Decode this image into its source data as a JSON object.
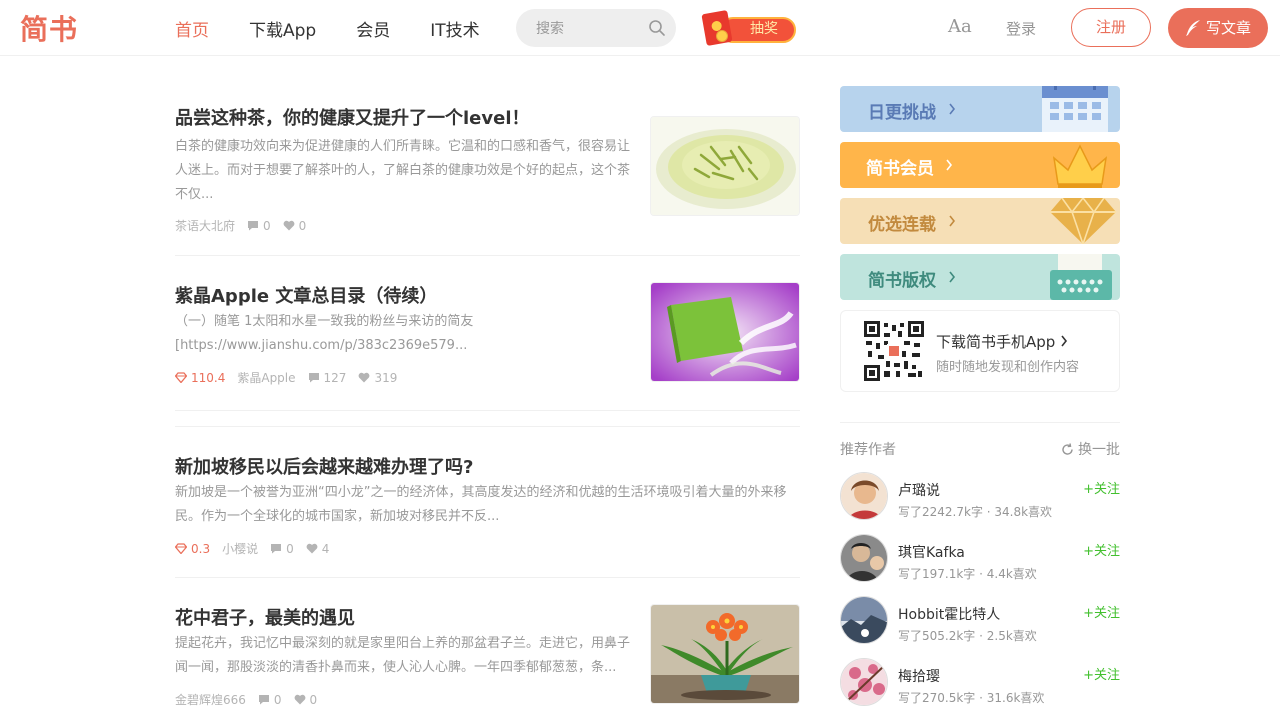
{
  "header": {
    "logo": "简书",
    "nav": [
      {
        "label": "首页",
        "active": true
      },
      {
        "label": "下载App",
        "active": false
      },
      {
        "label": "会员",
        "active": false
      },
      {
        "label": "IT技术",
        "active": false
      }
    ],
    "search_placeholder": "搜索",
    "lottery_label": "抽奖",
    "font_toggle": "Aa",
    "login_label": "登录",
    "register_label": "注册",
    "write_label": "写文章",
    "accent_color": "#ea6f5a"
  },
  "feed": [
    {
      "title": "品尝这种茶，你的健康又提升了一个level！",
      "abstract": "白茶的健康功效向来为促进健康的人们所青睐。它温和的口感和香气，很容易让人迷上。而对于想要了解茶叶的人，了解白茶的健康功效是个好的起点，这个茶不仅...",
      "author": "茶语大北府",
      "comments": "0",
      "likes": "0",
      "diamond": "",
      "thumb": "tea-cup"
    },
    {
      "title": "紫晶Apple 文章总目录（待续）",
      "abstract": "（一）随笔 1太阳和水星一致我的粉丝与来访的简友 [https://www.jianshu.com/p/383c2369e579...",
      "author": "紫晶Apple",
      "comments": "127",
      "likes": "319",
      "diamond": "110.4",
      "thumb": "book-lily"
    },
    {
      "title": "新加坡移民以后会越来越难办理了吗?",
      "abstract": "新加坡是一个被誉为亚洲“四小龙”之一的经济体，其高度发达的经济和优越的生活环境吸引着大量的外来移民。作为一个全球化的城市国家，新加坡对移民并不反...",
      "author": "小樱说",
      "comments": "0",
      "likes": "4",
      "diamond": "0.3",
      "thumb": ""
    },
    {
      "title": "花中君子，最美的遇见",
      "abstract": "提起花卉，我记忆中最深刻的就是家里阳台上养的那盆君子兰。走进它，用鼻子闻一闻，那股淡淡的清香扑鼻而来，使人沁人心脾。一年四季郁郁葱葱，条...",
      "author": "金碧辉煌666",
      "comments": "0",
      "likes": "0",
      "diamond": "",
      "thumb": "clivia"
    }
  ],
  "sidebar": {
    "banners": [
      {
        "label": "日更挑战",
        "bg": "#b7d3ed",
        "fg": "#5a7bb5",
        "icon": "calendar-icon"
      },
      {
        "label": "简书会员",
        "bg": "#ffb54a",
        "fg": "#ffffff",
        "icon": "crown-icon"
      },
      {
        "label": "优选连载",
        "bg": "#f6dfb6",
        "fg": "#c28a3e",
        "icon": "diamond-icon"
      },
      {
        "label": "简书版权",
        "bg": "#bfe4dd",
        "fg": "#3f8b7e",
        "icon": "typewriter-icon"
      }
    ],
    "download": {
      "title": "下载简书手机App",
      "subtitle": "随时随地发现和创作内容"
    },
    "recommend": {
      "title": "推荐作者",
      "refresh_label": "换一批",
      "follow_label": "+关注",
      "authors": [
        {
          "name": "卢璐说",
          "stats": "写了2242.7k字 · 34.8k喜欢"
        },
        {
          "name": "琪官Kafka",
          "stats": "写了197.1k字 · 4.4k喜欢"
        },
        {
          "name": "Hobbit霍比特人",
          "stats": "写了505.2k字 · 2.5k喜欢"
        },
        {
          "name": "梅拾璎",
          "stats": "写了270.5k字 · 31.6k喜欢"
        }
      ]
    }
  }
}
